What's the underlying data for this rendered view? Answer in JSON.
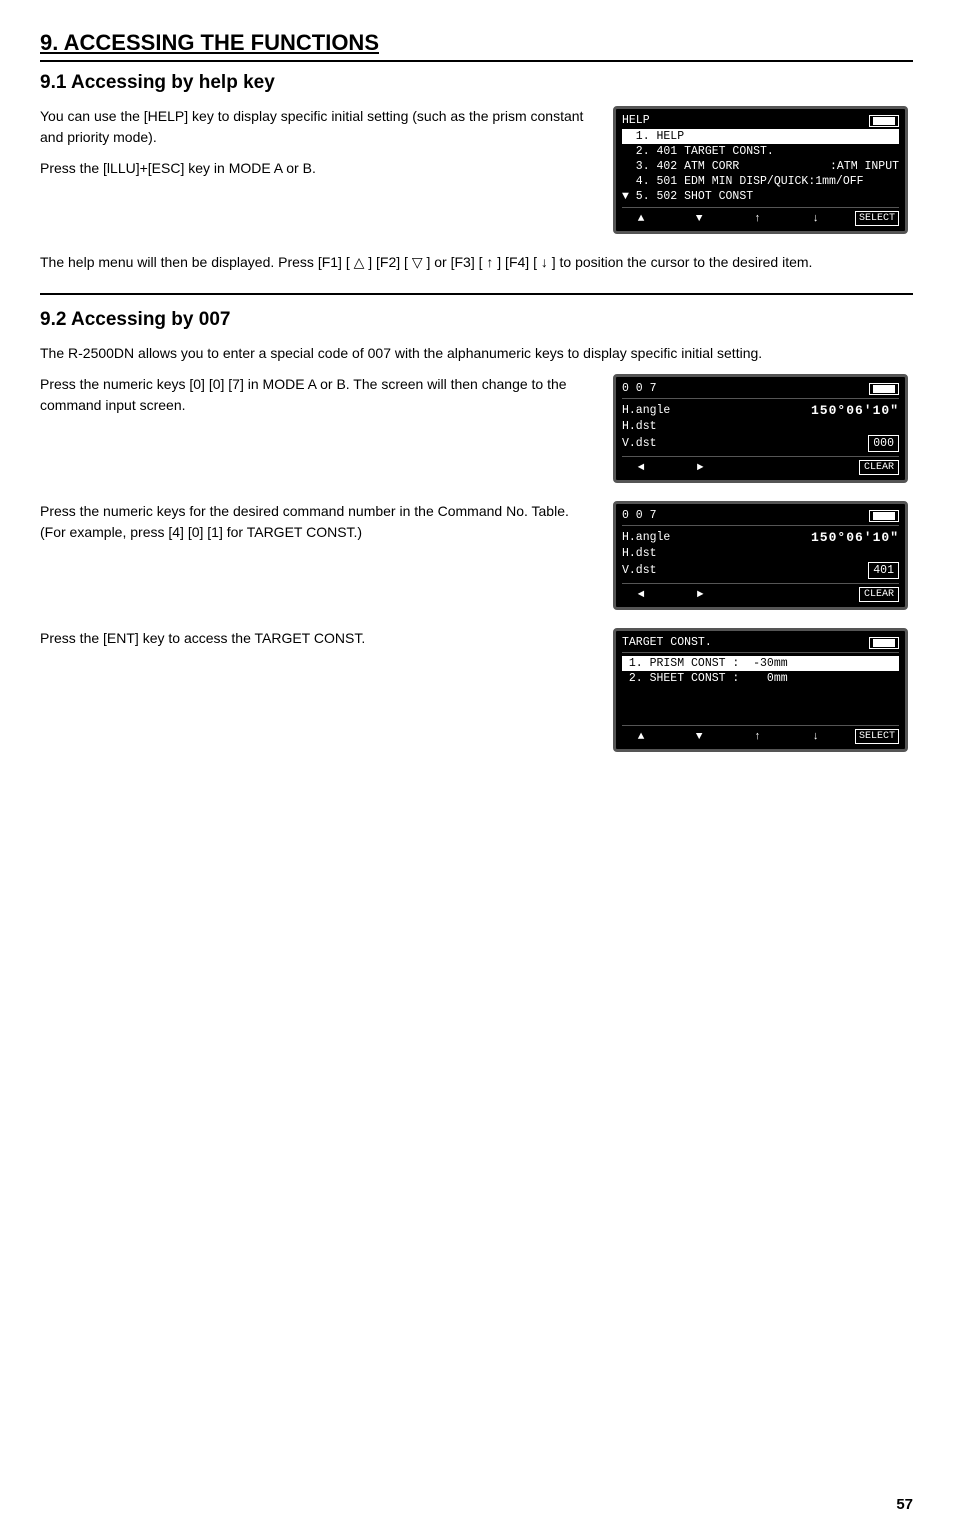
{
  "page": {
    "number": "57"
  },
  "heading": {
    "chapter": "9. ACCESSING THE FUNCTIONS",
    "section1_title": "9.1 Accessing by help key",
    "section2_title": "9.2 Accessing by 007"
  },
  "section1": {
    "para1": "You can use the [HELP] key to display specific initial setting (such as the prism constant and priority mode).",
    "para2": "Press the [lLLU]+[ESC] key in MODE A or B.",
    "para3": "The help menu will then be displayed. Press [F1] [ △ ] [F2] [ ▽  ] or [F3] [  ↑ ] [F4] [  ↓  ] to position the cursor to the desired item."
  },
  "section2": {
    "para1": "The R-2500DN allows you to enter a special code of 007 with the alphanumeric keys to display specific initial setting.",
    "para2": "Press the numeric keys [0] [0] [7] in MODE A or B. The screen will then change to the command input screen.",
    "para3": "Press the numeric keys for the desired command number in the Command No. Table.  (For example, press [4] [0] [1] for TARGET CONST.)",
    "para4": "Press the [ENT] key to access the TARGET CONST."
  },
  "screens": {
    "help_screen": {
      "title": "HELP",
      "items": [
        {
          "num": "1.",
          "label": "HELP",
          "highlight": true
        },
        {
          "num": "2.",
          "label": "401 TARGET CONST."
        },
        {
          "num": "3.",
          "label": "402 ATM CORR",
          "value": ":ATM INPUT"
        },
        {
          "num": "4.",
          "label": "501 EDM MIN DISP/QUICK",
          "value": ":1mm/OFF"
        },
        {
          "num": "▼ 5.",
          "label": "502 SHOT CONST"
        }
      ],
      "footer_buttons": [
        "▲",
        "▼",
        "↑",
        "↓",
        "SELECT"
      ]
    },
    "screen_007_empty": {
      "title": "0 0 7",
      "rows": [
        {
          "label": "H.angle",
          "value": "150° 06′ 10″",
          "large": true
        },
        {
          "label": "H.dst",
          "value": ""
        },
        {
          "label": "V.dst",
          "value": "",
          "box": "000"
        }
      ],
      "footer_buttons": [
        "◄",
        "►",
        "",
        "",
        "CLEAR"
      ]
    },
    "screen_007_401": {
      "title": "0 0 7",
      "rows": [
        {
          "label": "H.angle",
          "value": "150° 06′ 10″",
          "large": true
        },
        {
          "label": "H.dst",
          "value": ""
        },
        {
          "label": "V.dst",
          "value": "",
          "box": "401"
        }
      ],
      "footer_buttons": [
        "◄",
        "►",
        "",
        "",
        "CLEAR"
      ]
    },
    "target_const_screen": {
      "title": "TARGET CONST.",
      "items": [
        {
          "num": "1.",
          "label": "PRISM CONST :",
          "value": "-30mm",
          "highlight": true
        },
        {
          "num": "2.",
          "label": "SHEET CONST :",
          "value": "  0mm"
        }
      ],
      "footer_buttons": [
        "▲",
        "▼",
        "↑",
        "↓",
        "SELECT"
      ]
    }
  }
}
